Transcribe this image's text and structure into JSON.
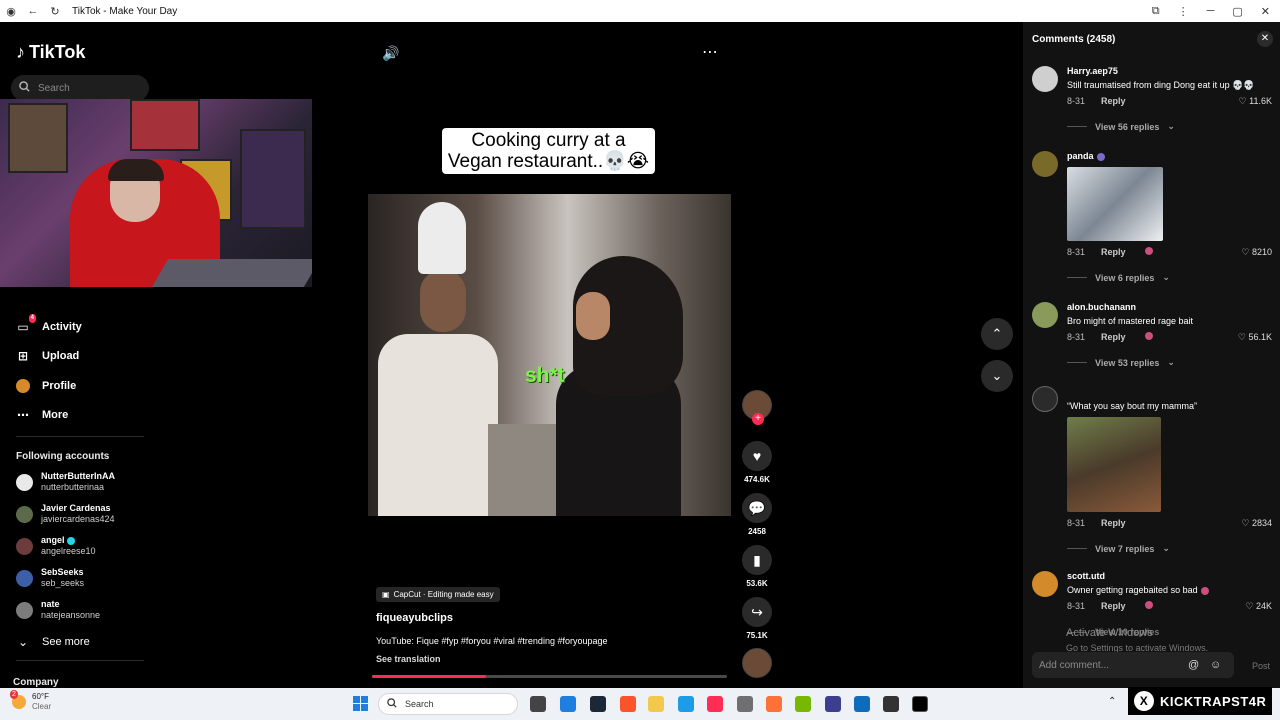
{
  "window": {
    "title": "TikTok - Make Your Day"
  },
  "sidebar": {
    "logo": "TikTok",
    "search_placeholder": "Search",
    "nav": [
      {
        "label": "Activity",
        "badge": "4",
        "icon": "inbox-icon"
      },
      {
        "label": "Upload",
        "icon": "plus-square-icon"
      },
      {
        "label": "Profile",
        "icon": "avatar-icon"
      },
      {
        "label": "More",
        "icon": "more-dots-icon"
      }
    ],
    "following_title": "Following accounts",
    "following": [
      {
        "name": "NutterButterInAA",
        "handle": "nutterbutterinaa"
      },
      {
        "name": "Javier Cardenas",
        "handle": "javiercardenas424"
      },
      {
        "name": "angel",
        "handle": "angelreese10",
        "verified": true
      },
      {
        "name": "SebSeeks",
        "handle": "seb_seeks"
      },
      {
        "name": "nate",
        "handle": "natejeansonne"
      }
    ],
    "see_more": "See more",
    "company": "Company"
  },
  "video": {
    "caption": "Cooking curry at a Vegan restaurant..💀😭",
    "overlay_text": "sh*t",
    "capcut_label": "CapCut · Editing made easy",
    "author": "fiqueayubclips",
    "description": "YouTube: Fique #fyp #foryou #viral #trending #foryoupage",
    "see_translation": "See translation",
    "progress": 0.32,
    "likes": "474.6K",
    "comments": "2458",
    "saves": "53.6K",
    "shares": "75.1K"
  },
  "comments_panel": {
    "title": "Comments (2458)",
    "add_placeholder": "Add comment...",
    "post_label": "Post",
    "items": [
      {
        "user": "Harry.aep75",
        "text": "Still traumatised from ding Dong eat it up 💀💀",
        "date": "8-31",
        "reply": "Reply",
        "likes": "11.6K",
        "views": "View 56 replies"
      },
      {
        "user": "panda",
        "text": "",
        "date": "8-31",
        "reply": "Reply",
        "likes": "8210",
        "views": "View 6 replies"
      },
      {
        "user": "alon.buchanann",
        "text": "Bro might of mastered rage bait",
        "date": "8-31",
        "reply": "Reply",
        "likes": "56.1K",
        "views": "View 53 replies"
      },
      {
        "user": "",
        "text": "“What you say bout my mamma”",
        "date": "8-31",
        "reply": "Reply",
        "likes": "2834",
        "views": "View 7 replies"
      },
      {
        "user": "scott.utd",
        "text": "Owner getting ragebaited so bad",
        "date": "8-31",
        "reply": "Reply",
        "likes": "24K",
        "views": "View 10 replies"
      }
    ]
  },
  "watermark": {
    "line1": "Activate Windows",
    "line2": "Go to Settings to activate Windows."
  },
  "taskbar": {
    "temp": "60°F",
    "condition": "Clear",
    "notif": "2",
    "search": "Search"
  },
  "overlay": {
    "kick_name": "KICKTRAPST4R"
  },
  "colors": {
    "accent": "#fe2c55",
    "overlay_green": "#7df34a",
    "verified": "#20d5ec"
  }
}
